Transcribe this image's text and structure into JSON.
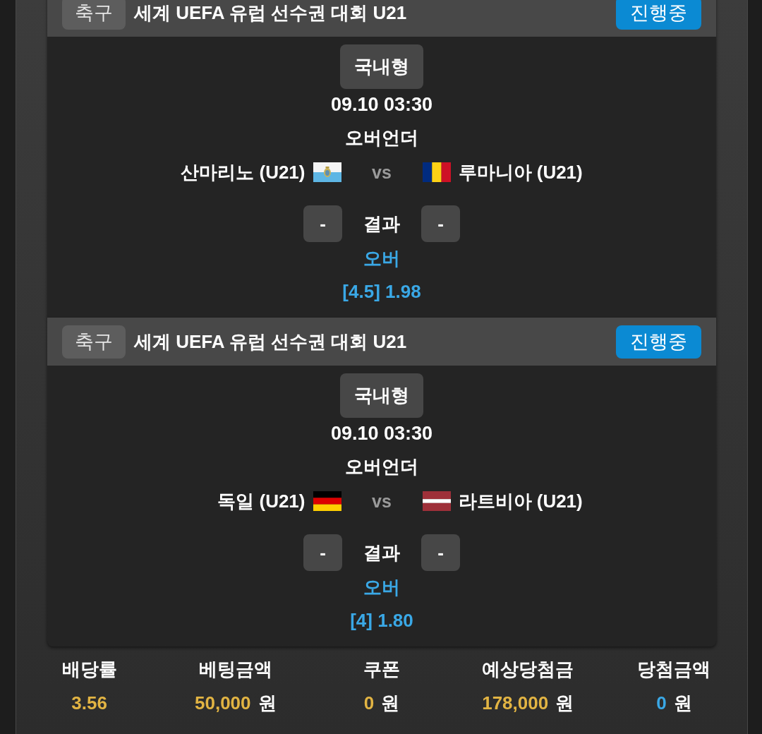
{
  "matches": [
    {
      "sport": "축구",
      "league": "세계 UEFA 유럽 선수권 대회 U21",
      "status": "진행중",
      "market": "국내형",
      "time": "09.10 03:30",
      "bet_type": "오버언더",
      "home": {
        "name": "산마리노 (U21)",
        "kind": "san-marino"
      },
      "vs": "vs",
      "away": {
        "name": "루마니아 (U21)",
        "kind": "romania"
      },
      "home_score": "-",
      "result_label": "결과",
      "away_score": "-",
      "pick": "오버",
      "odds": "[4.5] 1.98"
    },
    {
      "sport": "축구",
      "league": "세계 UEFA 유럽 선수권 대회 U21",
      "status": "진행중",
      "market": "국내형",
      "time": "09.10 03:30",
      "bet_type": "오버언더",
      "home": {
        "name": "독일 (U21)",
        "kind": "germany"
      },
      "vs": "vs",
      "away": {
        "name": "라트비아 (U21)",
        "kind": "latvia"
      },
      "home_score": "-",
      "result_label": "결과",
      "away_score": "-",
      "pick": "오버",
      "odds": "[4] 1.80"
    }
  ],
  "summary": [
    {
      "label": "배당률",
      "value": "3.56",
      "color": "#e2b443"
    },
    {
      "label": "베팅금액",
      "value": "50,000",
      "unit": "원",
      "color": "#e2b443"
    },
    {
      "label": "쿠폰",
      "value": "0",
      "unit": "원",
      "color": "#e2b443"
    },
    {
      "label": "예상당첨금",
      "value": "178,000",
      "unit": "원",
      "color": "#e2b443"
    },
    {
      "label": "당첨금액",
      "value": "0",
      "unit": "원",
      "color": "#3aa8e6"
    }
  ]
}
